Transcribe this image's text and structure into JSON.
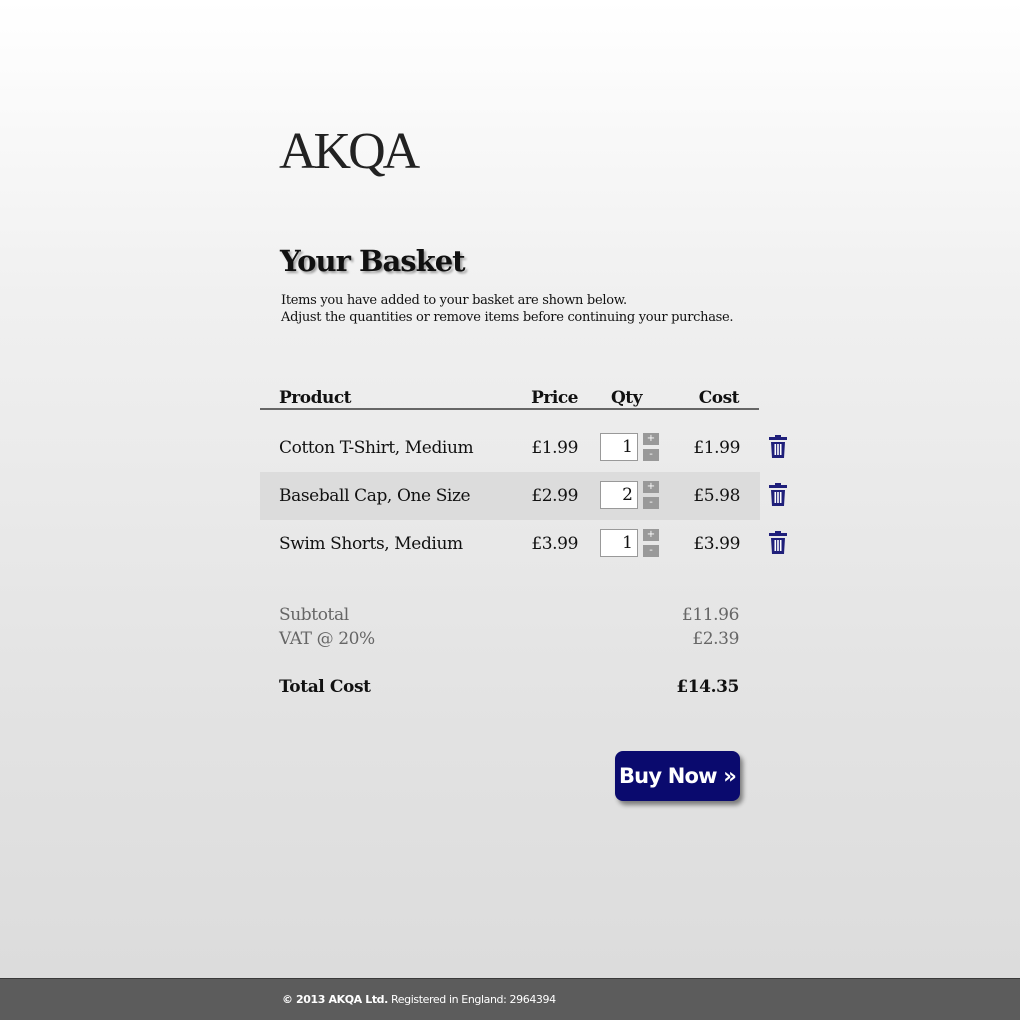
{
  "brand": {
    "logo": "AKQA"
  },
  "header": {
    "title": "Your Basket",
    "intro_line1": "Items you have added to your basket are shown below.",
    "intro_line2": "Adjust the quantities or remove items before continuing your purchase."
  },
  "table": {
    "columns": [
      "Product",
      "Price",
      "Qty",
      "Cost"
    ],
    "rows": [
      {
        "product": "Cotton T-Shirt, Medium",
        "price": "£1.99",
        "qty": "1",
        "cost": "£1.99"
      },
      {
        "product": "Baseball Cap, One Size",
        "price": "£2.99",
        "qty": "2",
        "cost": "£5.98"
      },
      {
        "product": "Swim Shorts, Medium",
        "price": "£3.99",
        "qty": "1",
        "cost": "£3.99"
      }
    ],
    "plus_label": "+",
    "minus_label": "-"
  },
  "summary": {
    "subtotal_label": "Subtotal",
    "subtotal_value": "£11.96",
    "vat_label": "VAT @ 20%",
    "vat_value": "£2.39",
    "total_label": "Total Cost",
    "total_value": "£14.35"
  },
  "actions": {
    "buy_label": "Buy Now »"
  },
  "footer": {
    "copyright": "© 2013 AKQA Ltd.",
    "registration": "Registered in England: 2964394"
  },
  "colors": {
    "accent": "#0a0a6e",
    "trash": "#1f1f7a",
    "footer_bg": "#5c5c5c",
    "alt_row": "#dcdcdc"
  },
  "icons": {
    "delete": "trash-icon"
  }
}
